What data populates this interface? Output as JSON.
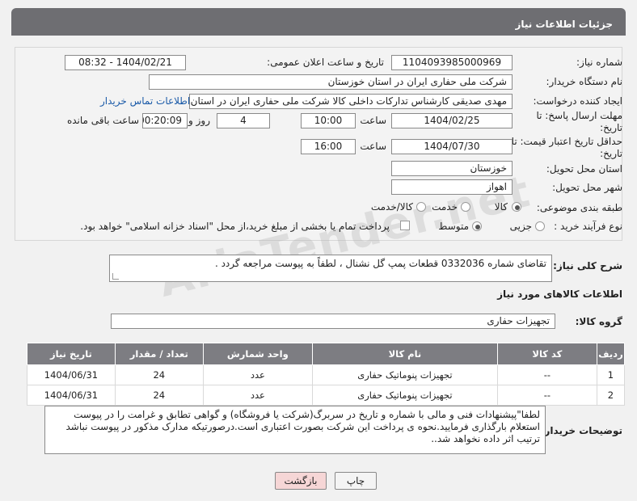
{
  "header": {
    "title": "جزئیات اطلاعات نیاز"
  },
  "form": {
    "need_number_label": "شماره نیاز:",
    "need_number": "1104093985000969",
    "announce_label": "تاریخ و ساعت اعلان عمومی:",
    "announce_value": "1404/02/21 - 08:32",
    "buyer_label": "نام دستگاه خریدار:",
    "buyer_value": "شرکت ملی حفاری ایران در استان خوزستان",
    "requester_label": "ایجاد کننده درخواست:",
    "requester_value": "مهدی صدیقی کارشناس تدارکات داخلی کالا شرکت ملی حفاری ایران در استان",
    "contact_link": "اطلاعات تماس خریدار",
    "deadline_label": "مهلت ارسال پاسخ: تا تاریخ:",
    "deadline_date": "1404/02/25",
    "time_word": "ساعت",
    "deadline_time": "10:00",
    "days_value": "4",
    "days_word": "روز و",
    "remaining_time": "00:20:09",
    "remaining_word": "ساعت باقی مانده",
    "validity_label": "حداقل تاریخ اعتبار قیمت: تا تاریخ:",
    "validity_date": "1404/07/30",
    "validity_time": "16:00",
    "province_label": "استان محل تحویل:",
    "province_value": "خوزستان",
    "city_label": "شهر محل تحویل:",
    "city_value": "اهواز",
    "category_label": "طبقه بندی موضوعی:",
    "category_options": [
      "کالا",
      "خدمت",
      "کالا/خدمت"
    ],
    "category_selected": "کالا",
    "process_label": "نوع فرآیند خرید :",
    "process_options": [
      "جزیی",
      "متوسط"
    ],
    "process_selected": "متوسط",
    "payment_note": "پرداخت تمام یا بخشی از مبلغ خرید،از محل \"اسناد خزانه اسلامی\" خواهد بود."
  },
  "description": {
    "label": "شرح کلی نیاز:",
    "value": "تقاضای شماره 0332036 قطعات پمپ گل نشنال ، لطفاً به پیوست مراجعه گردد ."
  },
  "goods": {
    "section_title": "اطلاعات کالاهای مورد نیاز",
    "group_label": "گروه کالا:",
    "group_value": "تجهیزات حفاری",
    "columns": [
      "ردیف",
      "کد کالا",
      "نام کالا",
      "واحد شمارش",
      "تعداد / مقدار",
      "تاریخ نیاز"
    ],
    "rows": [
      {
        "idx": "1",
        "code": "--",
        "name": "تجهیزات پنوماتیک حفاری",
        "unit": "عدد",
        "qty": "24",
        "date": "1404/06/31"
      },
      {
        "idx": "2",
        "code": "--",
        "name": "تجهیزات پنوماتیک حفاری",
        "unit": "عدد",
        "qty": "24",
        "date": "1404/06/31"
      }
    ]
  },
  "buyer_notes": {
    "label": "توضیحات خریدار:",
    "value": "لطفا\"پیشنهادات فنی و مالی با شماره و تاریخ در سربرگ(شرکت یا فروشگاه) و گواهی تطابق و غرامت را در پیوست استعلام بارگذاری فرمایید.نحوه ی پرداخت این شرکت بصورت اعتباری است.درصورتیکه مدارک مذکور در پیوست نباشد ترتیب اثر داده نخواهد شد.."
  },
  "buttons": {
    "print": "چاپ",
    "back": "بازگشت"
  },
  "watermark": "AriaTender.net"
}
